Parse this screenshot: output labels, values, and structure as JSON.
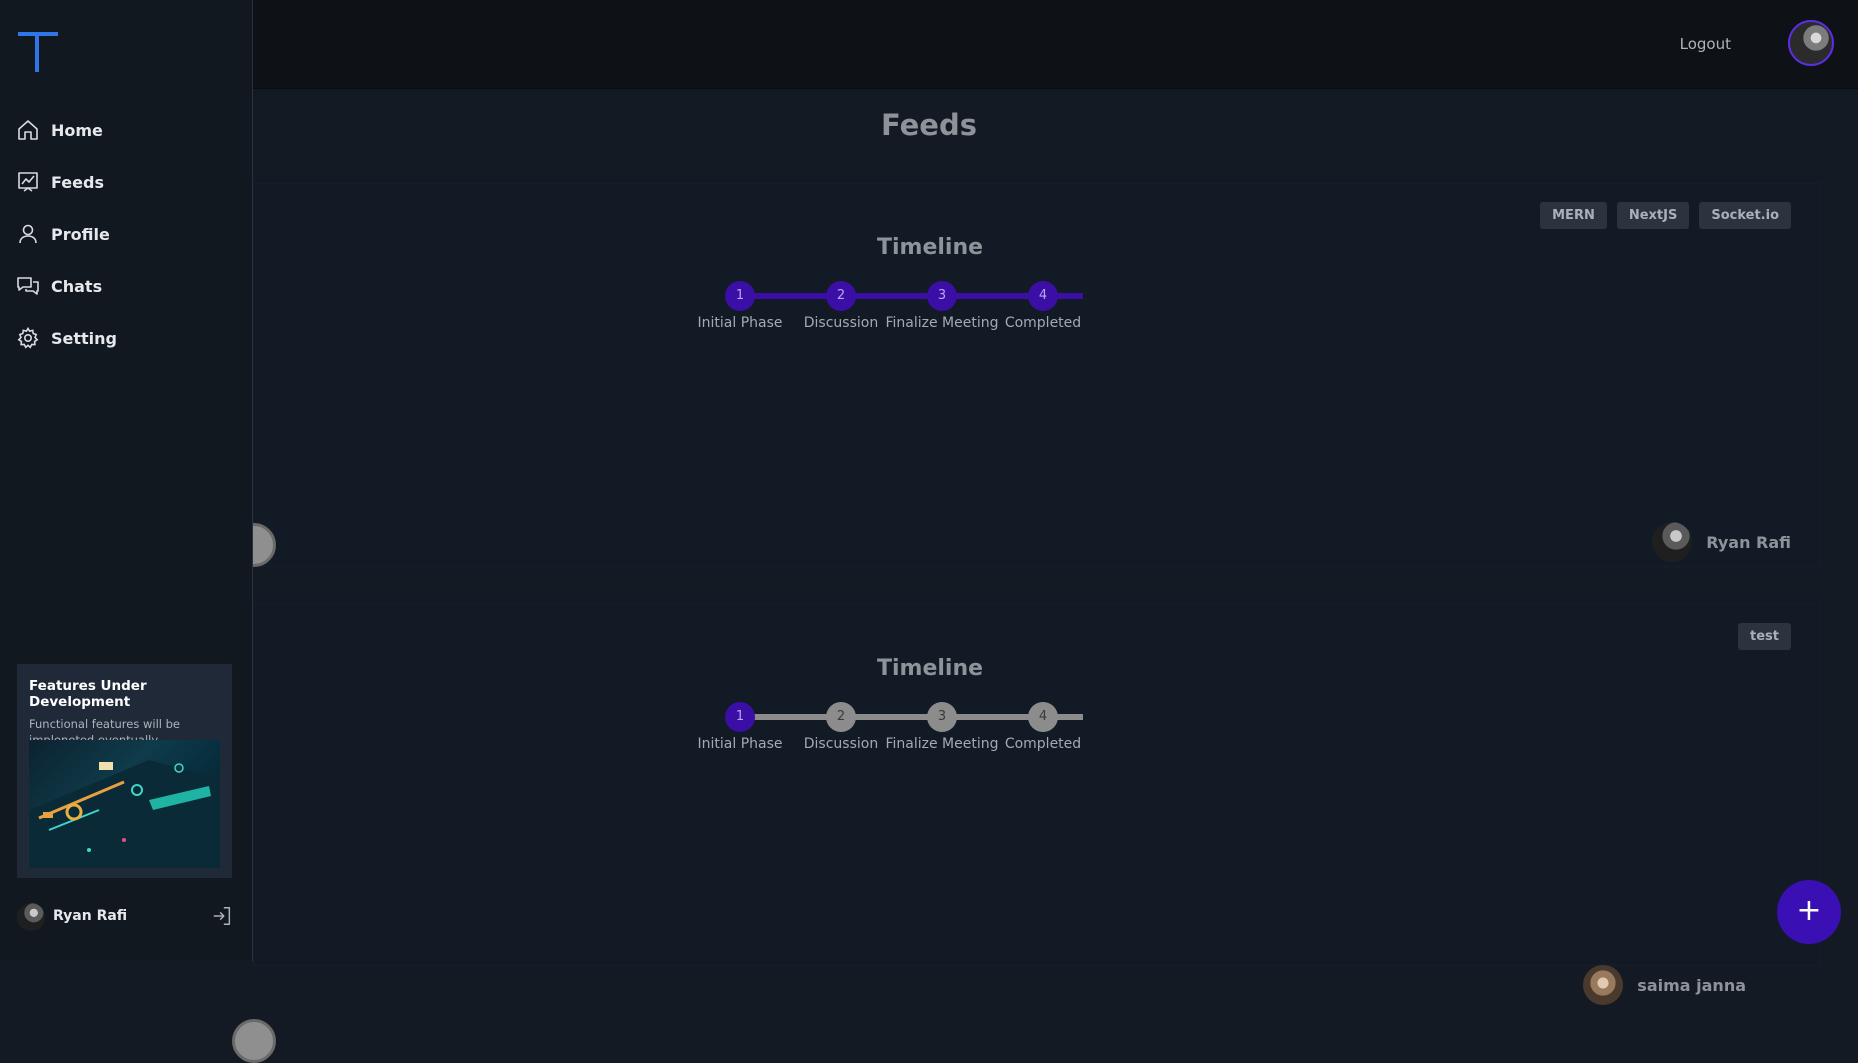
{
  "topbar": {
    "logout_label": "Logout"
  },
  "sidebar": {
    "items": [
      {
        "label": "Home",
        "icon": "home-icon"
      },
      {
        "label": "Feeds",
        "icon": "chart-icon"
      },
      {
        "label": "Profile",
        "icon": "user-icon"
      },
      {
        "label": "Chats",
        "icon": "chat-icon"
      },
      {
        "label": "Setting",
        "icon": "gear-icon"
      }
    ],
    "promo": {
      "title": "Features Under Development",
      "text": "Functional features will be impleneted eventually"
    },
    "user": {
      "name": "Ryan Rafi"
    }
  },
  "main": {
    "title": "Feeds",
    "posts": [
      {
        "tags": [
          "MERN",
          "NextJS",
          "Socket.io"
        ],
        "timeline_title": "Timeline",
        "steps": [
          {
            "num": "1",
            "label": "Initial Phase"
          },
          {
            "num": "2",
            "label": "Discussion"
          },
          {
            "num": "3",
            "label": "Finalize Meeting"
          },
          {
            "num": "4",
            "label": "Completed"
          }
        ],
        "completed_steps": 4,
        "author": "Ryan Rafi"
      },
      {
        "tags": [
          "test"
        ],
        "timeline_title": "Timeline",
        "steps": [
          {
            "num": "1",
            "label": "Initial Phase"
          },
          {
            "num": "2",
            "label": "Discussion"
          },
          {
            "num": "3",
            "label": "Finalize Meeting"
          },
          {
            "num": "4",
            "label": "Completed"
          }
        ],
        "completed_steps": 1,
        "author": "saima janna"
      }
    ]
  },
  "fab": {
    "label": "+"
  },
  "colors": {
    "accent": "#3b0ea5",
    "inactive": "#8c8c8c",
    "logo": "#2f77e8"
  }
}
